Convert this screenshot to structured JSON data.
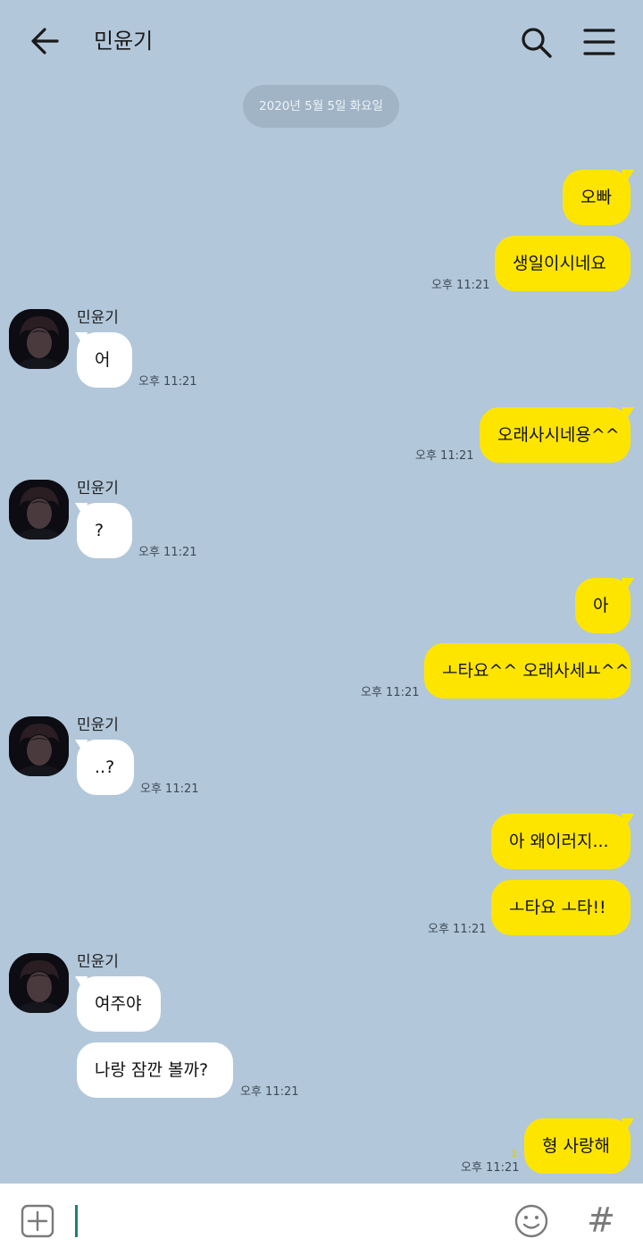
{
  "header": {
    "title": "민윤기"
  },
  "date_divider": "2020년 5월 5일 화요일",
  "messages": {
    "m1": {
      "text": "오빠"
    },
    "m2": {
      "text": "생일이시네요",
      "time": "오후 11:21"
    },
    "r1": {
      "sender": "민윤기",
      "text": "어",
      "time": "오후 11:21"
    },
    "m3": {
      "text": "오래사시네용^^",
      "time": "오후 11:21"
    },
    "r2": {
      "sender": "민윤기",
      "text": "?",
      "time": "오후 11:21"
    },
    "m4": {
      "text": "아"
    },
    "m5": {
      "text": "ㅗ타요^^ 오래사세ㅛ^^",
      "time": "오후 11:21"
    },
    "r3": {
      "sender": "민윤기",
      "text": "..?",
      "time": "오후 11:21"
    },
    "m6": {
      "text": "아 왜이러지..."
    },
    "m7": {
      "text": "ㅗ타요 ㅗ타!!",
      "time": "오후 11:21"
    },
    "r4": {
      "sender": "민윤기",
      "text": "여주야"
    },
    "r5": {
      "text": "나랑 잠깐 볼까?",
      "time": "오후 11:21"
    },
    "m8": {
      "text": "형 사랑해",
      "time": "오후 11:21",
      "unread": "1"
    }
  },
  "colors": {
    "background": "#b2c7da",
    "my_bubble": "#fee500",
    "their_bubble": "#ffffff",
    "input_cursor": "#1f7f74"
  },
  "icons": {
    "back": "arrow-left-icon",
    "search": "search-icon",
    "menu": "hamburger-menu-icon",
    "attach": "plus-square-icon",
    "emoji": "smiley-icon",
    "hashtag": "hash-icon"
  },
  "input": {
    "value": "",
    "hashtag_glyph": "#"
  }
}
